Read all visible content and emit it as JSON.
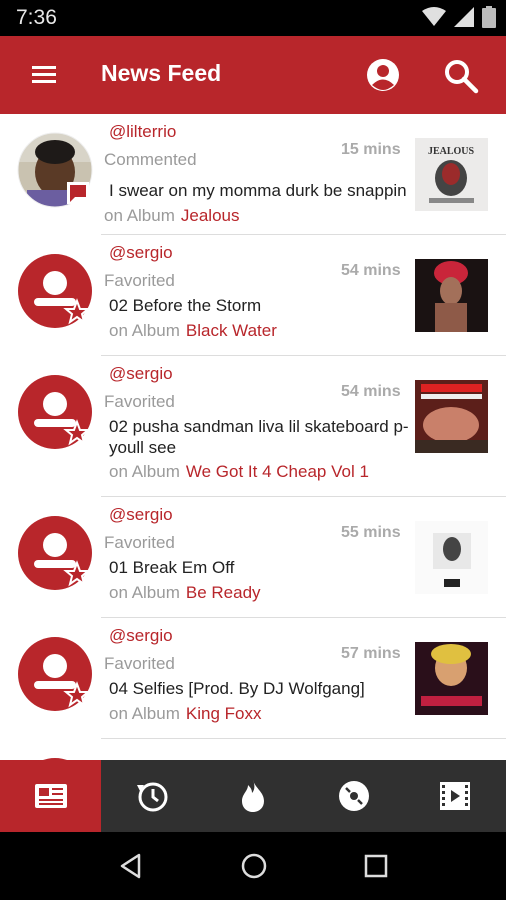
{
  "status_bar": {
    "time": "7:36"
  },
  "app_bar": {
    "title": "News Feed"
  },
  "feed": [
    {
      "handle": "@lilterrio",
      "action": "Commented",
      "time": "15 mins",
      "text": "I swear on my momma durk be snappin",
      "on_label": "on Album",
      "album": "Jealous"
    },
    {
      "handle": "@sergio",
      "action": "Favorited",
      "time": "54 mins",
      "text": "02 Before the Storm",
      "on_label": "on Album",
      "album": "Black Water"
    },
    {
      "handle": "@sergio",
      "action": "Favorited",
      "time": "54 mins",
      "text": "02 pusha sandman liva lil skateboard p-youll see",
      "on_label": "on Album",
      "album": "We Got It 4 Cheap Vol 1"
    },
    {
      "handle": "@sergio",
      "action": "Favorited",
      "time": "55 mins",
      "text": "01 Break Em Off",
      "on_label": "on Album",
      "album": "Be Ready"
    },
    {
      "handle": "@sergio",
      "action": "Favorited",
      "time": "57 mins",
      "text": "04 Selfies [Prod. By DJ Wolfgang]",
      "on_label": "on Album",
      "album": "King Foxx"
    }
  ],
  "colors": {
    "brand": "#b8262b",
    "tab_bg": "#303030"
  },
  "tabs": [
    "newspaper-icon",
    "history-icon",
    "fire-icon",
    "disc-icon",
    "video-icon"
  ]
}
